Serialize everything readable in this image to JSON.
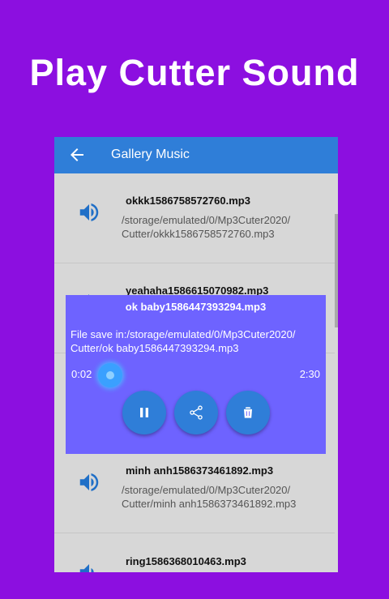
{
  "headline": "Play Cutter Sound",
  "appbar": {
    "back_icon": "arrow-left-icon",
    "title": "Gallery Music"
  },
  "files": [
    {
      "name": "okkk1586758572760.mp3",
      "path_line1": "/storage/emulated/0/Mp3Cuter2020/",
      "path_line2": "Cutter/okkk1586758572760.mp3"
    },
    {
      "name": "yeahaha1586615070982.mp3"
    },
    {
      "name": "minh anh1586373461892.mp3",
      "path_line1": "/storage/emulated/0/Mp3Cuter2020/",
      "path_line2": "Cutter/minh anh1586373461892.mp3"
    },
    {
      "name": "ring1586368010463.mp3"
    }
  ],
  "player": {
    "title": "ok baby1586447393294.mp3",
    "message_line1": "File save in:/storage/emulated/0/Mp3Cuter2020/",
    "message_line2": "Cutter/ok baby1586447393294.mp3",
    "current_time": "0:02",
    "total_time": "2:30",
    "progress_fraction": 0.013,
    "buttons": [
      "pause-icon",
      "share-icon",
      "delete-icon"
    ]
  },
  "colors": {
    "background": "#8c0fe0",
    "appbar": "#2f7ed8",
    "dialog": "#6e63ff",
    "icon_blue": "#1f6fc7"
  }
}
